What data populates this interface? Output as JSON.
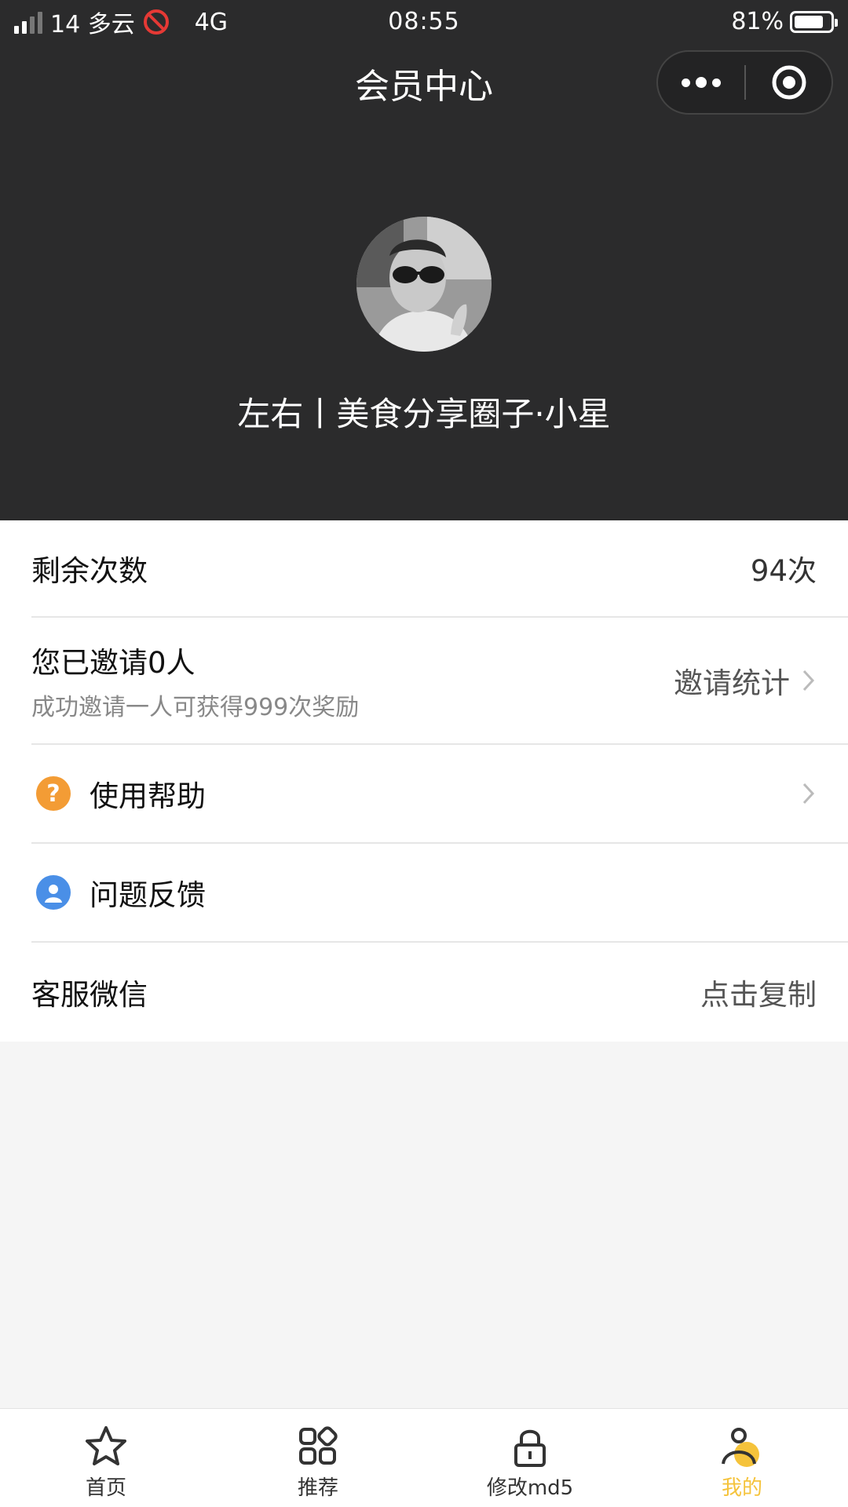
{
  "status_bar": {
    "carrier_info": "14 多云",
    "network": "4G",
    "time": "08:55",
    "battery": "81%",
    "battery_level": 0.81
  },
  "navbar": {
    "title": "会员中心",
    "more_icon": "more-dots-icon",
    "close_icon": "target-circle-icon"
  },
  "profile": {
    "name": "左右丨美食分享圈子·小星"
  },
  "list": {
    "remaining": {
      "label": "剩余次数",
      "value": "94次"
    },
    "invite": {
      "title": "您已邀请0人",
      "subtitle": "成功邀请一人可获得999次奖励",
      "action": "邀请统计"
    },
    "help": {
      "label": "使用帮助",
      "icon": "question-icon",
      "icon_color": "#f39c35"
    },
    "feedback": {
      "label": "问题反馈",
      "icon": "user-icon",
      "icon_color": "#4a8fe7"
    },
    "service": {
      "label": "客服微信",
      "action": "点击复制"
    }
  },
  "tabbar": {
    "items": [
      {
        "label": "首页",
        "icon": "star-icon"
      },
      {
        "label": "推荐",
        "icon": "grid-icon"
      },
      {
        "label": "修改md5",
        "icon": "lock-icon"
      },
      {
        "label": "我的",
        "icon": "person-icon",
        "active": true
      }
    ],
    "active_color": "#f5c33b"
  }
}
